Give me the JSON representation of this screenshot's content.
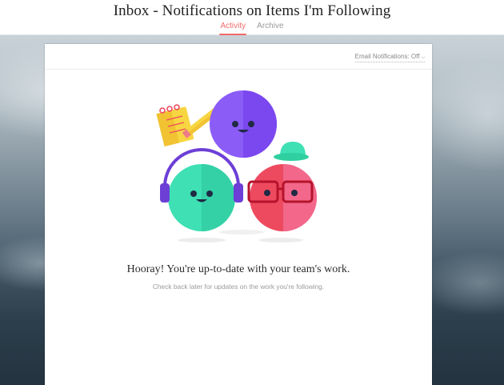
{
  "header": {
    "title": "Inbox - Notifications on Items I'm Following",
    "tabs": [
      {
        "label": "Activity",
        "active": true
      },
      {
        "label": "Archive",
        "active": false
      }
    ]
  },
  "card": {
    "email_notifications_label": "Email Notifications: Off",
    "message_title": "Hooray! You're up-to-date with your team's work.",
    "message_subtitle": "Check back later for updates on the work you're following."
  },
  "colors": {
    "accent": "#f06a6a",
    "purple_face": "#8b5cf6",
    "teal_face": "#3ee0b4",
    "red_face": "#ee4a5f",
    "notepad": "#f7d642",
    "hat": "#3ee0b4"
  },
  "icons": [
    "chevron-down-icon",
    "notepad-icon",
    "pencil-icon",
    "headphones-icon",
    "glasses-icon",
    "hat-icon"
  ]
}
